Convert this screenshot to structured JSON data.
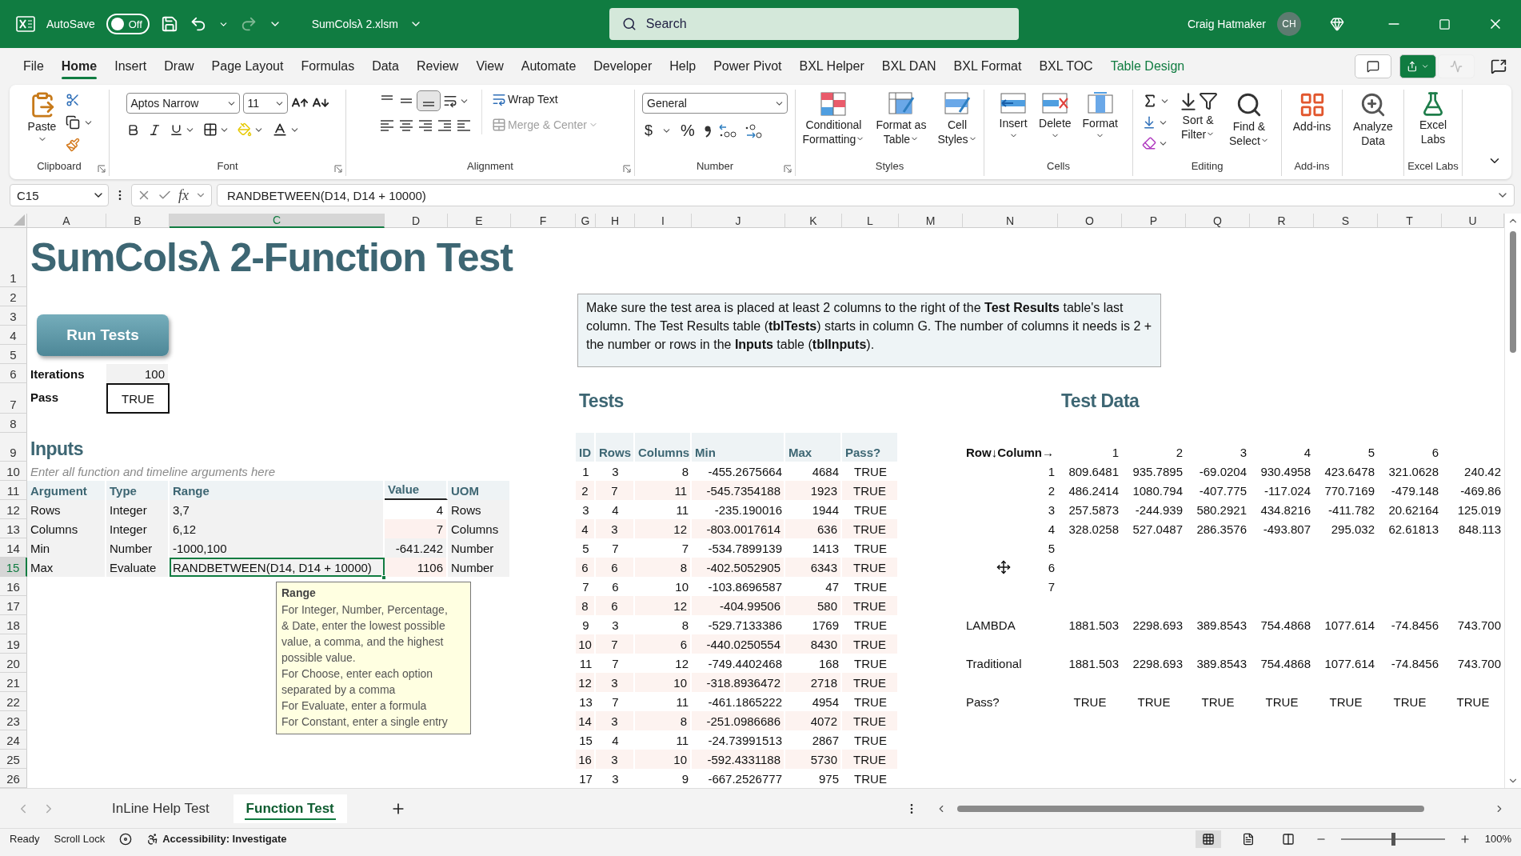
{
  "title_bar": {
    "autosave": {
      "label": "AutoSave",
      "state_text": "Off",
      "on": false
    },
    "file_name": "SumColsλ 2.xlsm",
    "search": {
      "placeholder": "Search"
    },
    "user": {
      "name": "Craig Hatmaker",
      "initials": "CH"
    }
  },
  "menu_tabs": [
    {
      "label": "File",
      "selected": false,
      "kind": "normal"
    },
    {
      "label": "Home",
      "selected": true,
      "kind": "normal"
    },
    {
      "label": "Insert",
      "selected": false,
      "kind": "normal"
    },
    {
      "label": "Draw",
      "selected": false,
      "kind": "normal"
    },
    {
      "label": "Page Layout",
      "selected": false,
      "kind": "normal"
    },
    {
      "label": "Formulas",
      "selected": false,
      "kind": "normal"
    },
    {
      "label": "Data",
      "selected": false,
      "kind": "normal"
    },
    {
      "label": "Review",
      "selected": false,
      "kind": "normal"
    },
    {
      "label": "View",
      "selected": false,
      "kind": "normal"
    },
    {
      "label": "Automate",
      "selected": false,
      "kind": "normal"
    },
    {
      "label": "Developer",
      "selected": false,
      "kind": "normal"
    },
    {
      "label": "Help",
      "selected": false,
      "kind": "normal"
    },
    {
      "label": "Power Pivot",
      "selected": false,
      "kind": "normal"
    },
    {
      "label": "BXL Helper",
      "selected": false,
      "kind": "normal"
    },
    {
      "label": "BXL DAN",
      "selected": false,
      "kind": "normal"
    },
    {
      "label": "BXL Format",
      "selected": false,
      "kind": "normal"
    },
    {
      "label": "BXL TOC",
      "selected": false,
      "kind": "normal"
    },
    {
      "label": "Table Design",
      "selected": false,
      "kind": "contextual"
    }
  ],
  "ribbon": [
    {
      "kind": "clipboard",
      "label": "Clipboard",
      "launcher": true,
      "paste": "Paste"
    },
    {
      "kind": "font",
      "label": "Font",
      "launcher": true,
      "font_name": "Aptos Narrow",
      "font_size": "11"
    },
    {
      "kind": "alignment",
      "label": "Alignment",
      "launcher": true,
      "wrap": "Wrap Text",
      "merge": {
        "label": "Merge & Center",
        "disabled": true
      }
    },
    {
      "kind": "number",
      "label": "Number",
      "launcher": true,
      "format": "General",
      "currency": "$",
      "percent": "%"
    },
    {
      "kind": "styles",
      "label": "Styles",
      "launcher": false,
      "buttons": [
        {
          "lines": [
            "Conditional",
            "Formatting"
          ]
        },
        {
          "lines": [
            "Format as",
            "Table"
          ]
        },
        {
          "lines": [
            "Cell",
            "Styles"
          ]
        }
      ]
    },
    {
      "kind": "cells",
      "label": "Cells",
      "launcher": false,
      "buttons": [
        {
          "lines": [
            "Insert"
          ]
        },
        {
          "lines": [
            "Delete"
          ]
        },
        {
          "lines": [
            "Format"
          ]
        }
      ]
    },
    {
      "kind": "editing",
      "label": "Editing",
      "launcher": false,
      "buttons": [
        {
          "lines": [
            "Sort &",
            "Filter"
          ]
        },
        {
          "lines": [
            "Find &",
            "Select"
          ]
        }
      ]
    },
    {
      "kind": "addins",
      "label": "Add-ins",
      "launcher": false,
      "buttons": [
        {
          "lines": [
            "Add-ins"
          ]
        }
      ]
    },
    {
      "kind": "analyze",
      "launcher": false,
      "buttons": [
        {
          "lines": [
            "Analyze",
            "Data"
          ]
        }
      ]
    },
    {
      "kind": "labs",
      "label": "Excel Labs",
      "launcher": false,
      "buttons": [
        {
          "lines": [
            "Excel",
            "Labs"
          ]
        }
      ]
    }
  ],
  "formula_bar": {
    "name_box": "C15",
    "function_symbol": "fx",
    "formula": "RANDBETWEEN(D14, D14 + 10000)"
  },
  "column_headers": [
    {
      "label": "A",
      "selected": false
    },
    {
      "label": "B",
      "selected": false
    },
    {
      "label": "C",
      "selected": true
    },
    {
      "label": "D",
      "selected": false
    },
    {
      "label": "E",
      "selected": false
    },
    {
      "label": "F",
      "selected": false
    },
    {
      "label": "G",
      "selected": false
    },
    {
      "label": "H",
      "selected": false
    },
    {
      "label": "I",
      "selected": false
    },
    {
      "label": "J",
      "selected": false
    },
    {
      "label": "K",
      "selected": false
    },
    {
      "label": "L",
      "selected": false
    },
    {
      "label": "M",
      "selected": false
    },
    {
      "label": "N",
      "selected": false
    },
    {
      "label": "O",
      "selected": false
    },
    {
      "label": "P",
      "selected": false
    },
    {
      "label": "Q",
      "selected": false
    },
    {
      "label": "R",
      "selected": false
    },
    {
      "label": "S",
      "selected": false
    },
    {
      "label": "T",
      "selected": false
    },
    {
      "label": "U",
      "selected": false
    }
  ],
  "row_headers": [
    {
      "label": "1",
      "selected": false
    },
    {
      "label": "2",
      "selected": false
    },
    {
      "label": "3",
      "selected": false
    },
    {
      "label": "4",
      "selected": false
    },
    {
      "label": "5",
      "selected": false
    },
    {
      "label": "6",
      "selected": false
    },
    {
      "label": "7",
      "selected": false
    },
    {
      "label": "8",
      "selected": false
    },
    {
      "label": "9",
      "selected": false
    },
    {
      "label": "10",
      "selected": false
    },
    {
      "label": "11",
      "selected": false
    },
    {
      "label": "12",
      "selected": false
    },
    {
      "label": "13",
      "selected": false
    },
    {
      "label": "14",
      "selected": false
    },
    {
      "label": "15",
      "selected": true
    },
    {
      "label": "16",
      "selected": false
    },
    {
      "label": "17",
      "selected": false
    },
    {
      "label": "18",
      "selected": false
    },
    {
      "label": "19",
      "selected": false
    },
    {
      "label": "20",
      "selected": false
    },
    {
      "label": "21",
      "selected": false
    },
    {
      "label": "22",
      "selected": false
    },
    {
      "label": "23",
      "selected": false
    },
    {
      "label": "24",
      "selected": false
    },
    {
      "label": "25",
      "selected": false
    },
    {
      "label": "26",
      "selected": false
    }
  ],
  "sheet": {
    "title": "SumColsλ 2-Function Test",
    "run_button": "Run Tests",
    "iterations": {
      "label": "Iterations",
      "value": "100"
    },
    "pass": {
      "label": "Pass",
      "value": "TRUE"
    },
    "inputs": {
      "heading": "Inputs",
      "hint": "Enter all function and timeline arguments here",
      "columns": [
        "Argument",
        "Type",
        "Range",
        "Value",
        "UOM"
      ],
      "rows": [
        {
          "cells": [
            "Rows",
            "Integer",
            "3,7",
            "4",
            "Rows"
          ],
          "selected": false
        },
        {
          "cells": [
            "Columns",
            "Integer",
            "6,12",
            "7",
            "Columns"
          ],
          "selected": false
        },
        {
          "cells": [
            "Min",
            "Number",
            "-1000,100",
            "-641.242",
            "Number"
          ],
          "selected": false
        },
        {
          "cells": [
            "Max",
            "Evaluate",
            "RANDBETWEEN(D14, D14 + 10000)",
            "1106",
            "Number"
          ],
          "selected": true
        }
      ]
    },
    "comment": {
      "title": "Range",
      "lines": [
        "For Integer, Number, Percentage,",
        "& Date, enter the lowest possible",
        "value, a comma, and the highest",
        "possible value.",
        "For Choose, enter each option",
        "separated by a comma",
        "For Evaluate, enter a formula",
        "For Constant, enter a single entry"
      ]
    },
    "note": "Make sure the test area is placed at least 2 columns to the right of the **Test Results** table's last column.  The Test Results table  (**tblTests**) starts in column G. The number of columns it needs is 2 + the number or rows in the **Inputs** table (**tblInputs**).",
    "tests": {
      "heading": "Tests",
      "columns": [
        "ID",
        "Rows",
        "Columns",
        "Min",
        "Max",
        "Pass?"
      ],
      "rows": [
        [
          "1",
          "3",
          "8",
          "-455.2675664",
          "4684",
          "TRUE"
        ],
        [
          "2",
          "7",
          "11",
          "-545.7354188",
          "1923",
          "TRUE"
        ],
        [
          "3",
          "4",
          "11",
          "-235.190016",
          "1944",
          "TRUE"
        ],
        [
          "4",
          "3",
          "12",
          "-803.0017614",
          "636",
          "TRUE"
        ],
        [
          "5",
          "7",
          "7",
          "-534.7899139",
          "1413",
          "TRUE"
        ],
        [
          "6",
          "6",
          "8",
          "-402.5052905",
          "6343",
          "TRUE"
        ],
        [
          "7",
          "6",
          "10",
          "-103.8696587",
          "47",
          "TRUE"
        ],
        [
          "8",
          "6",
          "12",
          "-404.99506",
          "580",
          "TRUE"
        ],
        [
          "9",
          "3",
          "8",
          "-529.7133386",
          "1769",
          "TRUE"
        ],
        [
          "10",
          "7",
          "6",
          "-440.0250554",
          "8430",
          "TRUE"
        ],
        [
          "11",
          "7",
          "12",
          "-749.4402468",
          "168",
          "TRUE"
        ],
        [
          "12",
          "3",
          "10",
          "-318.8936472",
          "2718",
          "TRUE"
        ],
        [
          "13",
          "7",
          "11",
          "-461.1865222",
          "4954",
          "TRUE"
        ],
        [
          "14",
          "3",
          "8",
          "-251.0986686",
          "4072",
          "TRUE"
        ],
        [
          "15",
          "4",
          "11",
          "-24.73991513",
          "2867",
          "TRUE"
        ],
        [
          "16",
          "3",
          "10",
          "-592.4331188",
          "5730",
          "TRUE"
        ],
        [
          "17",
          "3",
          "9",
          "-667.2526777",
          "975",
          "TRUE"
        ]
      ]
    },
    "test_data": {
      "heading": "Test Data",
      "corner": "Row↓Column→",
      "column_numbers": [
        "1",
        "2",
        "3",
        "4",
        "5",
        "6"
      ],
      "rows": [
        {
          "label": "1",
          "values": [
            "809.6481",
            "935.7895",
            "-69.0204",
            "930.4958",
            "423.6478",
            "321.0628",
            "240.42"
          ]
        },
        {
          "label": "2",
          "values": [
            "486.2414",
            "1080.794",
            "-407.775",
            "-117.024",
            "770.7169",
            "-479.148",
            "-469.86"
          ]
        },
        {
          "label": "3",
          "values": [
            "257.5873",
            "-244.939",
            "580.2921",
            "434.8216",
            "-411.782",
            "20.62164",
            "125.019"
          ]
        },
        {
          "label": "4",
          "values": [
            "328.0258",
            "527.0487",
            "286.3576",
            "-493.807",
            "295.032",
            "62.61813",
            "848.113"
          ]
        },
        {
          "label": "5",
          "values": []
        },
        {
          "label": "6",
          "values": []
        },
        {
          "label": "7",
          "values": []
        }
      ],
      "summary": [
        {
          "label": "LAMBDA",
          "kind": "number",
          "values": [
            "1881.503",
            "2298.693",
            "389.8543",
            "754.4868",
            "1077.614",
            "-74.8456",
            "743.700"
          ]
        },
        {
          "label": "Traditional",
          "kind": "number",
          "values": [
            "1881.503",
            "2298.693",
            "389.8543",
            "754.4868",
            "1077.614",
            "-74.8456",
            "743.700"
          ]
        },
        {
          "label": "Pass?",
          "kind": "boolean",
          "values": [
            "TRUE",
            "TRUE",
            "TRUE",
            "TRUE",
            "TRUE",
            "TRUE",
            "TRUE"
          ]
        }
      ]
    }
  },
  "sheet_tabs": [
    {
      "label": "InLine Help Test",
      "selected": false
    },
    {
      "label": "Function Test",
      "selected": true
    }
  ],
  "status_bar": {
    "ready": "Ready",
    "scroll_lock": "Scroll Lock",
    "accessibility": "Accessibility: Investigate",
    "views": [
      {
        "selected": true
      },
      {
        "selected": false
      },
      {
        "selected": false
      }
    ],
    "zoom": {
      "level": 0.5,
      "reading": "100%"
    }
  }
}
